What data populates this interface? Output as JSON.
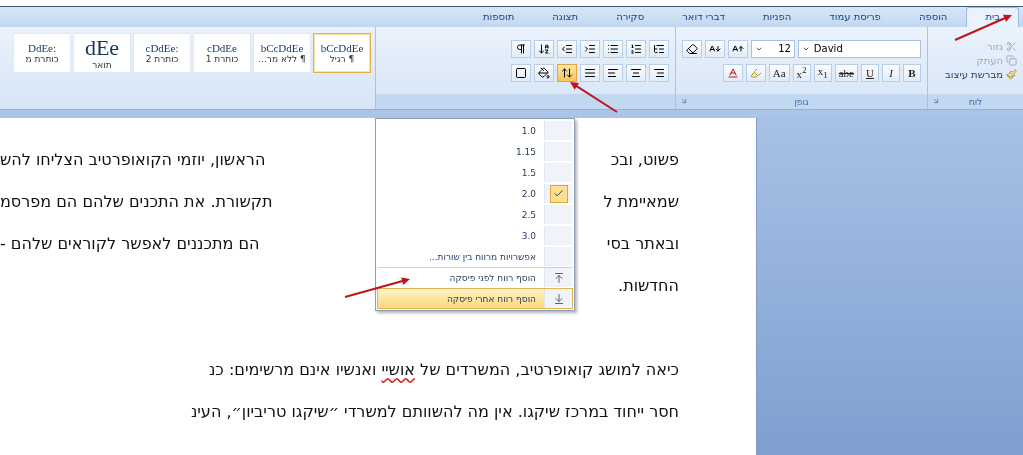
{
  "tabs": [
    {
      "label": "בית",
      "selected": true
    },
    {
      "label": "הוספה",
      "selected": false
    },
    {
      "label": "פריסת עמוד",
      "selected": false
    },
    {
      "label": "הפניות",
      "selected": false
    },
    {
      "label": "דברי דואר",
      "selected": false
    },
    {
      "label": "סקירה",
      "selected": false
    },
    {
      "label": "תצוגה",
      "selected": false
    },
    {
      "label": "תוספות",
      "selected": false
    }
  ],
  "clipboard": {
    "label": "לוח",
    "items": [
      {
        "kind": "cut",
        "label": "גזור",
        "disabled": true
      },
      {
        "kind": "copy",
        "label": "העתק",
        "disabled": true
      },
      {
        "kind": "brush",
        "label": "מברשת עיצוב",
        "disabled": false
      }
    ]
  },
  "font": {
    "label": "גופן",
    "size": "12",
    "name": "David",
    "format_buttons": [
      {
        "text": "B",
        "kind": "bold"
      },
      {
        "text": "I",
        "kind": "italic"
      },
      {
        "text": "U",
        "kind": "underline"
      },
      {
        "text": "abe",
        "kind": "strike"
      },
      {
        "text": "x$_{1}$",
        "kind": "plain"
      },
      {
        "text": "x$^{2}$",
        "kind": "plain"
      },
      {
        "text": "Aa",
        "kind": "plain"
      }
    ]
  },
  "paragraph": {
    "line_spacing_active": true
  },
  "styles": [
    {
      "sample": "bCcDdEe",
      "label": "¶ רגיל",
      "selected": true
    },
    {
      "sample": "bCcDdEe",
      "label": "¶ ללא מר...",
      "selected": false
    },
    {
      "sample": "cDdEe",
      "label": "כותרת 1",
      "selected": false
    },
    {
      "sample": ":cDdEe",
      "label": "כותרת 2",
      "selected": false
    },
    {
      "sample": "dEe",
      "label": "תואר",
      "selected": false
    },
    {
      "sample": ":DdEe",
      "label": "כותרת מ",
      "selected": false
    }
  ],
  "menu": {
    "items": [
      {
        "kind": "value",
        "label": "1.0",
        "checked": false
      },
      {
        "kind": "value",
        "label": "1.15",
        "checked": false
      },
      {
        "kind": "value",
        "label": "1.5",
        "checked": false
      },
      {
        "kind": "value",
        "label": "2.0",
        "checked": true
      },
      {
        "kind": "value",
        "label": "2.5",
        "checked": false
      },
      {
        "kind": "value",
        "label": "3.0",
        "checked": false
      },
      {
        "kind": "command",
        "label": "אפשרויות מרווח בין שורות...",
        "selected": false
      },
      {
        "kind": "before",
        "label": "הוסף רווח לפני פיסקה",
        "selected": false
      },
      {
        "kind": "after",
        "label": "הוסף רווח אחרי פיסקה",
        "selected": true
      }
    ]
  },
  "document": {
    "lines": [
      {
        "kind": "split",
        "start": "פשוט, ובכ",
        "end": "הראשון, יוזמי הקואופרטיב הצליחו להש"
      },
      {
        "kind": "split",
        "start": "שמאיימת ל",
        "end": "תקשורת. את התכנים שלהם הם מפרסמ"
      },
      {
        "kind": "split",
        "start": "ובאתר בסי",
        "end": "הם מתכננים לאפשר לקוראים שלהם -"
      },
      {
        "kind": "split",
        "start": "החדשות."
      },
      {
        "kind": "blank"
      },
      {
        "kind": "rich",
        "segments": [
          {
            "text": "כיאה למושג קואופרטיב, המשרדים של ",
            "misspelled": false
          },
          {
            "text": "אושיי",
            "misspelled": true
          },
          {
            "text": " ואנשיו אינם מרשימים: כנ",
            "misspelled": false
          }
        ]
      },
      {
        "kind": "rich",
        "segments": [
          {
            "text": "חסר ייחוד במרכז שיקגו. אין מה להשוותם למשרדי ״שיקגו טריביון״, העינ",
            "misspelled": false
          }
        ]
      }
    ]
  }
}
